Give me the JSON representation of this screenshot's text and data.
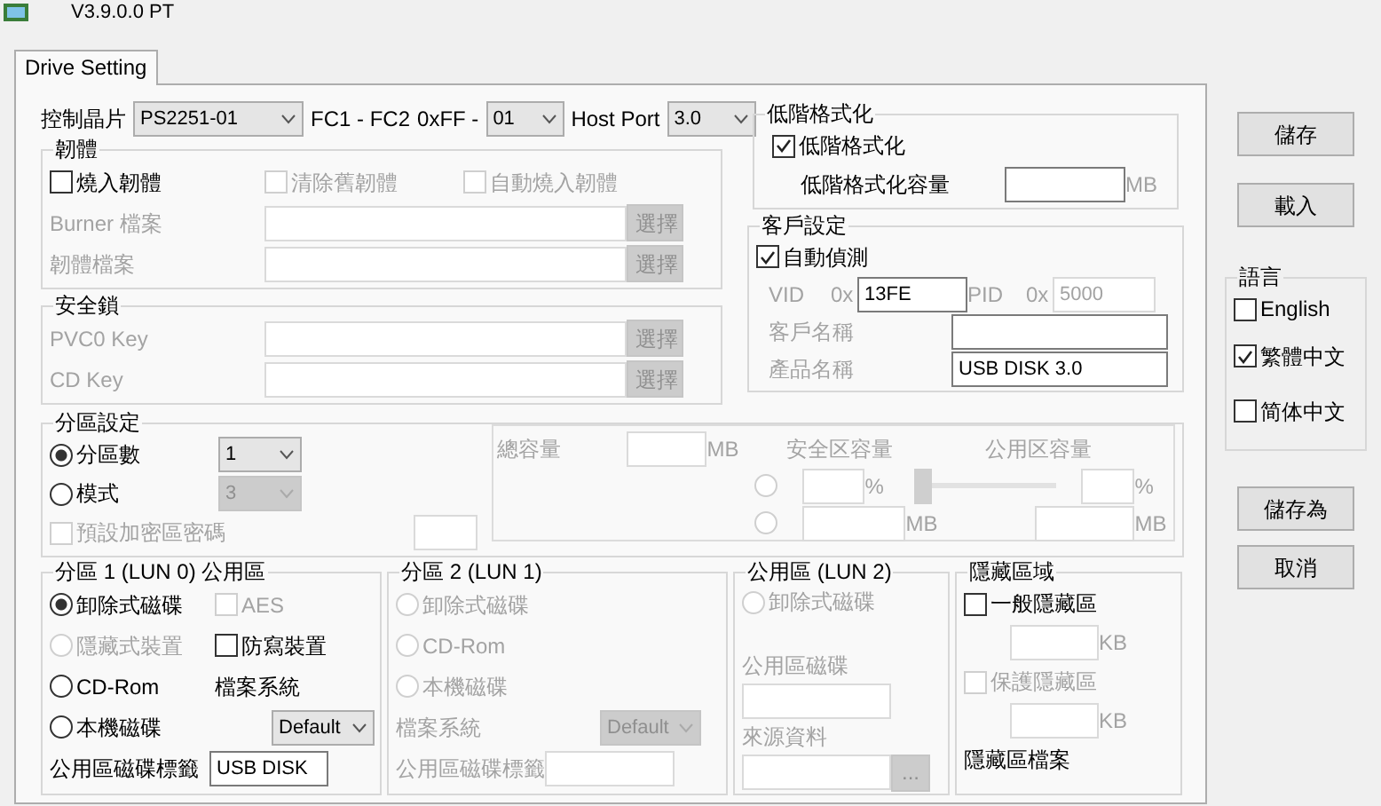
{
  "window": {
    "title": "V3.9.0.0 PT"
  },
  "tabs": [
    {
      "label": "Drive Setting",
      "selected": true
    }
  ],
  "controller_row": [
    {
      "kind": "label",
      "text": "控制晶片",
      "disabled": false
    },
    {
      "kind": "select",
      "value": "PS2251-01",
      "disabled": false
    },
    {
      "kind": "label",
      "text": "FC1 - FC2",
      "disabled": false
    },
    {
      "kind": "label",
      "text": "0xFF -",
      "disabled": false
    },
    {
      "kind": "select",
      "value": "01",
      "disabled": false
    },
    {
      "kind": "label",
      "text": "Host Port",
      "disabled": false
    },
    {
      "kind": "select",
      "value": "3.0",
      "disabled": false
    }
  ],
  "groups": [
    {
      "title": "韌體",
      "rows": [
        [
          {
            "kind": "check",
            "label": "燒入韌體",
            "checked": false,
            "disabled": false
          },
          {
            "kind": "check",
            "label": "清除舊韌體",
            "checked": false,
            "disabled": true
          },
          {
            "kind": "check",
            "label": "自動燒入韌體",
            "checked": false,
            "disabled": true
          }
        ],
        [
          {
            "kind": "label",
            "text": "Burner 檔案",
            "disabled": true
          },
          {
            "kind": "input",
            "disabled": true
          },
          {
            "kind": "button",
            "label": "選擇",
            "disabled": true
          }
        ],
        [
          {
            "kind": "label",
            "text": "韌體檔案",
            "disabled": true
          },
          {
            "kind": "input",
            "disabled": true
          },
          {
            "kind": "button",
            "label": "選擇",
            "disabled": true
          }
        ]
      ]
    },
    {
      "title": "安全鎖",
      "rows": [
        [
          {
            "kind": "label",
            "text": "PVC0 Key",
            "disabled": true
          },
          {
            "kind": "input",
            "disabled": true
          },
          {
            "kind": "button",
            "label": "選擇",
            "disabled": true
          }
        ],
        [
          {
            "kind": "label",
            "text": "CD Key",
            "disabled": true
          },
          {
            "kind": "input",
            "disabled": true
          },
          {
            "kind": "button",
            "label": "選擇",
            "disabled": true
          }
        ]
      ]
    },
    {
      "title": "低階格式化",
      "rows": [
        [
          {
            "kind": "check",
            "label": "低階格式化",
            "checked": true,
            "disabled": false
          }
        ],
        [
          {
            "kind": "label",
            "text": "低階格式化容量",
            "disabled": false
          },
          {
            "kind": "input",
            "disabled": false
          },
          {
            "kind": "label",
            "text": "MB",
            "disabled": true
          }
        ]
      ]
    },
    {
      "title": "客戶設定",
      "auto_detect": {
        "kind": "check",
        "label": "自動偵測",
        "checked": true,
        "disabled": false
      },
      "ids": [
        {
          "kind": "label",
          "text": "VID",
          "disabled": true
        },
        {
          "kind": "label",
          "text": "0x",
          "disabled": true
        },
        {
          "kind": "input",
          "value": "13FE",
          "disabled": false
        },
        {
          "kind": "label",
          "text": "PID",
          "disabled": true
        },
        {
          "kind": "label",
          "text": "0x",
          "disabled": true
        },
        {
          "kind": "input",
          "value": "5000",
          "disabled": true
        }
      ],
      "rows": [
        [
          {
            "kind": "label",
            "text": "客戶名稱",
            "disabled": true
          },
          {
            "kind": "input",
            "disabled": false
          }
        ],
        [
          {
            "kind": "label",
            "text": "產品名稱",
            "disabled": true
          },
          {
            "kind": "input",
            "value": "USB DISK 3.0",
            "disabled": false
          }
        ]
      ]
    },
    {
      "title": "分區設定",
      "rows": [
        [
          {
            "kind": "radio",
            "label": "分區數",
            "selected": true,
            "disabled": false
          },
          {
            "kind": "select",
            "value": "1",
            "disabled": false
          }
        ],
        [
          {
            "kind": "radio",
            "label": "模式",
            "selected": false,
            "disabled": false
          },
          {
            "kind": "select",
            "value": "3",
            "disabled": true
          }
        ],
        [
          {
            "kind": "check",
            "label": "預設加密區密碼",
            "checked": false,
            "disabled": true
          },
          {
            "kind": "input",
            "disabled": true
          }
        ]
      ],
      "panel_rows": [
        [
          {
            "kind": "label",
            "text": "總容量",
            "disabled": true
          },
          {
            "kind": "input",
            "disabled": true
          },
          {
            "kind": "label",
            "text": "MB",
            "disabled": true
          },
          {
            "kind": "label",
            "text": "安全区容量",
            "disabled": true
          },
          {
            "kind": "label",
            "text": "公用区容量",
            "disabled": true
          }
        ],
        [
          {
            "kind": "radio",
            "selected": false,
            "disabled": true
          },
          {
            "kind": "input",
            "disabled": true
          },
          {
            "kind": "label",
            "text": "%",
            "disabled": true
          },
          {
            "kind": "slider",
            "level": 0,
            "disabled": true
          },
          {
            "kind": "input",
            "disabled": true
          },
          {
            "kind": "label",
            "text": "%",
            "disabled": true
          }
        ],
        [
          {
            "kind": "radio",
            "selected": false,
            "disabled": true
          },
          {
            "kind": "input",
            "disabled": true
          },
          {
            "kind": "label",
            "text": "MB",
            "disabled": true
          },
          {
            "kind": "input",
            "disabled": true
          },
          {
            "kind": "label",
            "text": "MB",
            "disabled": true
          }
        ]
      ]
    },
    {
      "title": "分區 1 (LUN 0) 公用區",
      "rows": [
        [
          {
            "kind": "radio",
            "label": "卸除式磁碟",
            "selected": true,
            "disabled": false
          },
          {
            "kind": "check",
            "label": "AES",
            "checked": false,
            "disabled": true
          }
        ],
        [
          {
            "kind": "radio",
            "label": "隱藏式裝置",
            "selected": false,
            "disabled": true
          },
          {
            "kind": "check",
            "label": "防寫裝置",
            "checked": false,
            "disabled": false
          }
        ],
        [
          {
            "kind": "radio",
            "label": "CD-Rom",
            "selected": false,
            "disabled": false
          },
          {
            "kind": "label",
            "text": "檔案系統",
            "disabled": false
          }
        ],
        [
          {
            "kind": "radio",
            "label": "本機磁碟",
            "selected": false,
            "disabled": false
          },
          {
            "kind": "select",
            "value": "Default",
            "disabled": false
          }
        ],
        [
          {
            "kind": "label",
            "text": "公用區磁碟標籤",
            "disabled": false
          },
          {
            "kind": "input",
            "value": "USB DISK",
            "disabled": false
          }
        ]
      ]
    },
    {
      "title": "分區 2 (LUN 1)",
      "rows": [
        [
          {
            "kind": "radio",
            "label": "卸除式磁碟",
            "selected": false,
            "disabled": true
          }
        ],
        [
          {
            "kind": "radio",
            "label": "CD-Rom",
            "selected": false,
            "disabled": true
          }
        ],
        [
          {
            "kind": "radio",
            "label": "本機磁碟",
            "selected": false,
            "disabled": true
          }
        ],
        [
          {
            "kind": "label",
            "text": "檔案系統",
            "disabled": true
          },
          {
            "kind": "select",
            "value": "Default",
            "disabled": true
          }
        ],
        [
          {
            "kind": "label",
            "text": "公用區磁碟標籤",
            "disabled": true
          },
          {
            "kind": "input",
            "disabled": true
          }
        ]
      ]
    },
    {
      "title": "公用區 (LUN 2)",
      "rows": [
        [
          {
            "kind": "radio",
            "label": "卸除式磁碟",
            "selected": false,
            "disabled": true
          }
        ],
        [
          {
            "kind": "label",
            "text": "公用區磁碟",
            "disabled": true
          }
        ],
        [
          {
            "kind": "input",
            "disabled": true
          }
        ],
        [
          {
            "kind": "label",
            "text": "來源資料",
            "disabled": true
          }
        ],
        [
          {
            "kind": "input",
            "disabled": true
          },
          {
            "kind": "button",
            "label": "...",
            "disabled": true
          }
        ]
      ]
    },
    {
      "title": "隱藏區域",
      "rows": [
        [
          {
            "kind": "check",
            "label": "一般隱藏區",
            "checked": false,
            "disabled": false
          }
        ],
        [
          {
            "kind": "input",
            "disabled": true
          },
          {
            "kind": "label",
            "text": "KB",
            "disabled": true
          }
        ],
        [
          {
            "kind": "check",
            "label": "保護隱藏區",
            "checked": false,
            "disabled": true
          }
        ],
        [
          {
            "kind": "input",
            "disabled": true
          },
          {
            "kind": "label",
            "text": "KB",
            "disabled": true
          }
        ],
        [
          {
            "kind": "label",
            "text": "隱藏區檔案",
            "disabled": false
          }
        ]
      ]
    }
  ],
  "side_buttons_top": [
    {
      "label": "儲存"
    },
    {
      "label": "載入"
    }
  ],
  "language": {
    "title": "語言",
    "options": [
      {
        "label": "English",
        "checked": false
      },
      {
        "label": "繁體中文",
        "checked": true
      },
      {
        "label": "简体中文",
        "checked": false
      }
    ]
  },
  "side_buttons_bottom": [
    {
      "label": "儲存為"
    },
    {
      "label": "取消"
    }
  ]
}
